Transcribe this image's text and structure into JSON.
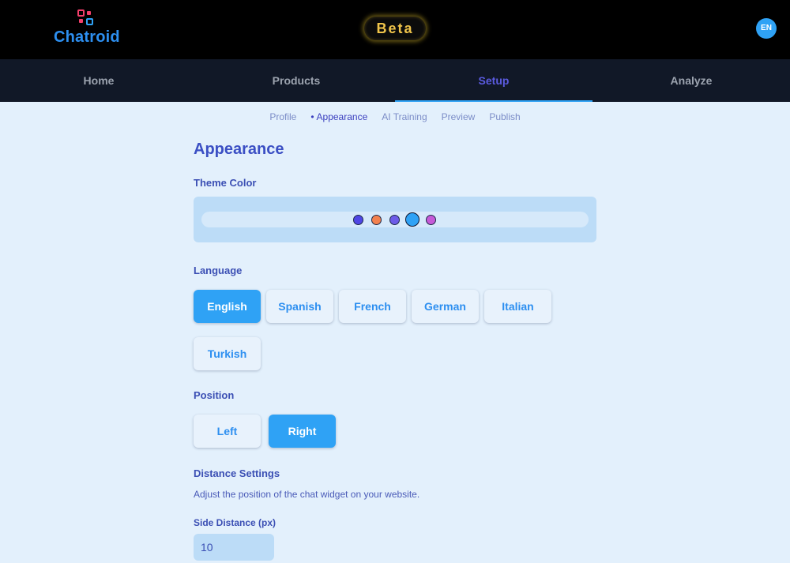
{
  "header": {
    "logo_text": "Chatroid",
    "beta_label": "Beta",
    "language_badge": "EN"
  },
  "nav": {
    "tabs": [
      {
        "label": "Home"
      },
      {
        "label": "Products"
      },
      {
        "label": "Setup"
      },
      {
        "label": "Analyze"
      }
    ],
    "active": "Setup"
  },
  "subnav": {
    "items": [
      {
        "label": "Profile"
      },
      {
        "label": "Appearance"
      },
      {
        "label": "AI Training"
      },
      {
        "label": "Preview"
      },
      {
        "label": "Publish"
      }
    ],
    "active": "Appearance",
    "active_marker": "•"
  },
  "page": {
    "title": "Appearance"
  },
  "theme_color": {
    "label": "Theme Color",
    "swatches": [
      {
        "name": "indigo",
        "color": "#4f46e5"
      },
      {
        "name": "orange",
        "color": "#f3814f"
      },
      {
        "name": "violet",
        "color": "#6d5ce8"
      },
      {
        "name": "sky-blue",
        "color": "#2fa2f5",
        "selected": true
      },
      {
        "name": "magenta",
        "color": "#c65ad8"
      }
    ]
  },
  "language": {
    "label": "Language",
    "options": [
      "English",
      "Spanish",
      "French",
      "German",
      "Italian",
      "Turkish"
    ],
    "selected": "English"
  },
  "position": {
    "label": "Position",
    "options": [
      "Left",
      "Right"
    ],
    "selected": "Right"
  },
  "distance": {
    "label": "Distance Settings",
    "description": "Adjust the position of the chat widget on your website.",
    "side_label": "Side Distance (px)",
    "side_value": "10"
  },
  "colors": {
    "accent": "#2fa2f5",
    "active_nav": "#5b5be0",
    "background": "#e3f0fc"
  }
}
